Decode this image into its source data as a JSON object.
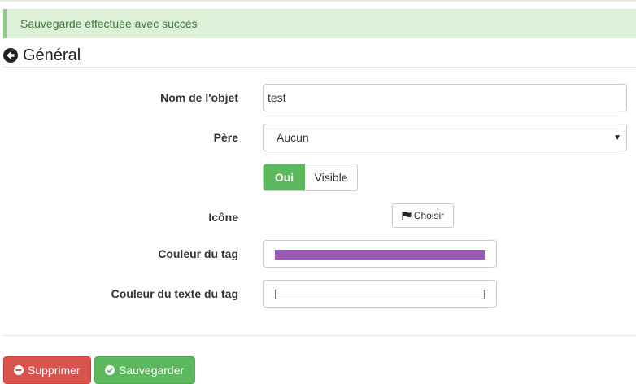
{
  "alert": {
    "message": "Sauvegarde effectuée avec succès"
  },
  "header": {
    "title": "Général",
    "back_icon": "arrow-circle-left-icon"
  },
  "form": {
    "name": {
      "label": "Nom de l'objet",
      "value": "test"
    },
    "parent": {
      "label": "Père",
      "selected": "Aucun"
    },
    "visibility": {
      "on_label": "Oui",
      "off_label": "Visible",
      "state": "on"
    },
    "icon": {
      "label": "Icône",
      "button_label": "Choisir",
      "button_icon": "flag-icon"
    },
    "tag_color": {
      "label": "Couleur du tag",
      "color": "#9b59b6"
    },
    "tag_text_color": {
      "label": "Couleur du texte du tag",
      "color": "#ffffff"
    }
  },
  "actions": {
    "delete_label": "Supprimer",
    "delete_icon": "minus-circle-icon",
    "save_label": "Sauvegarder",
    "save_icon": "check-circle-icon"
  },
  "colors": {
    "success": "#5cb85c",
    "danger": "#d9534f",
    "alert_bg": "#dff0d8",
    "alert_text": "#3c763d"
  }
}
